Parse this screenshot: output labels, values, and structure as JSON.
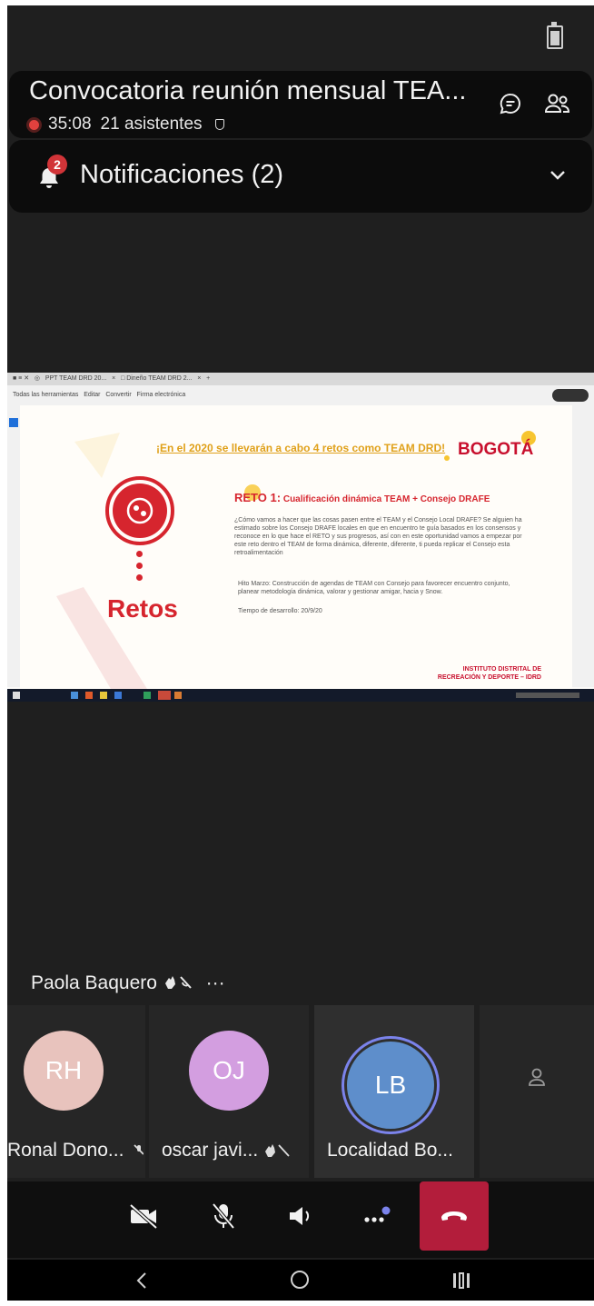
{
  "meeting": {
    "title": "Convocatoria reunión mensual TEA...",
    "timer": "35:08",
    "attendees": "21 asistentes"
  },
  "notifications": {
    "label": "Notificaciones (2)",
    "count": "2"
  },
  "shared_slide": {
    "banner": "¡En el 2020 se llevarán a cabo 4 retos como TEAM DRD!",
    "logo": "BOGOTÁ",
    "section": "Retos",
    "reto_number": "RETO 1:",
    "reto_title": "Cualificación dinámica TEAM + Consejo DRAFE",
    "body": "¿Cómo vamos a hacer que las cosas pasen entre el TEAM y el Consejo Local DRAFE? Se alguien ha estimado sobre los Consejo DRAFE locales en que en encuentro te guía basados en los consensos y reconoce en lo que hace el RETO y sus progresos, así con en este oportunidad vamos a empezar por este reto dentro el TEAM de forma dinámica, diferente, diferente, ti pueda replicar el Consejo esta retroalimentación",
    "bullet1": "Hito Marzo: Construcción de agendas de TEAM con Consejo para favorecer encuentro conjunto, planear metodología dinámica, valorar y gestionar amigar, hacia y Snow.",
    "bullet2": "Tiempo de desarrollo: 20/9/20",
    "institution": "INSTITUTO DISTRITAL DE RECREACIÓN Y DEPORTE – IDRD"
  },
  "active_speaker": {
    "name": "Paola Baquero",
    "more": "···"
  },
  "participants": [
    {
      "initials": "RH",
      "name": "Ronal Dono...",
      "color": "#e8c3bd"
    },
    {
      "initials": "OJ",
      "name": "oscar javi...",
      "color": "#d39ee0"
    },
    {
      "initials": "LB",
      "name": "Localidad  Bo...",
      "color": "#5e8ecb"
    }
  ],
  "colors": {
    "hangup": "#b31d3b",
    "badge": "#d13438",
    "accent_ring": "#7b83eb"
  },
  "icons": [
    "battery-icon",
    "chat-icon",
    "people-icon",
    "bell-icon",
    "chevron-down-icon",
    "camera-off-icon",
    "mic-off-icon",
    "speaker-icon",
    "more-options-icon",
    "hangup-icon",
    "back-icon",
    "home-icon",
    "recents-icon",
    "person-icon"
  ]
}
